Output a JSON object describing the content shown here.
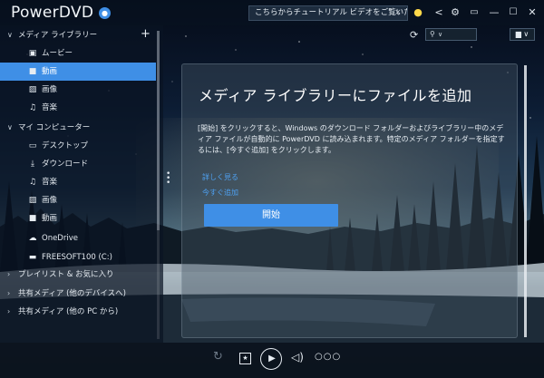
{
  "titlebar": {
    "app_title": "PowerDVD",
    "tip_text": "こちらからチュートリアル ビデオをご覧いただけます。",
    "tip_close": "×",
    "icons": [
      "notification-bell-icon",
      "lightbulb-icon",
      "share-icon",
      "gear-icon",
      "tv-mode-icon",
      "minimize-icon",
      "maximize-icon",
      "close-icon"
    ]
  },
  "sidebar": {
    "add_label": "+",
    "sections": [
      {
        "label": "メディア ライブラリー",
        "expanded": true,
        "items": [
          {
            "label": "ムービー",
            "icon": "movie-icon"
          },
          {
            "label": "動画",
            "icon": "video-icon",
            "selected": true
          },
          {
            "label": "画像",
            "icon": "image-icon"
          },
          {
            "label": "音楽",
            "icon": "music-icon"
          }
        ]
      },
      {
        "label": "マイ コンピューター",
        "expanded": true,
        "items": [
          {
            "label": "デスクトップ",
            "icon": "desktop-icon"
          },
          {
            "label": "ダウンロード",
            "icon": "download-icon"
          },
          {
            "label": "音楽",
            "icon": "music-icon"
          },
          {
            "label": "画像",
            "icon": "image-icon"
          },
          {
            "label": "動画",
            "icon": "video-icon"
          },
          {
            "label": "OneDrive",
            "icon": "cloud-icon"
          },
          {
            "label": "FREESOFT100 (C:)",
            "icon": "drive-icon"
          }
        ]
      },
      {
        "label": "プレイリスト & お気に入り",
        "expanded": false
      },
      {
        "label": "共有メディア (他のデバイスへ)",
        "expanded": false
      },
      {
        "label": "共有メディア (他の PC から)",
        "expanded": false
      }
    ]
  },
  "main": {
    "title": "メディア ライブラリーにファイルを追加",
    "description": "[開始] をクリックすると、Windows のダウンロード フォルダーおよびライブラリー中のメディア ファイルが自動的に PowerDVD に読み込まれます。特定のメディア フォルダーを指定するには、[今すぐ追加] をクリックします。",
    "link1": "詳しく見る",
    "link2": "今すぐ追加",
    "start_button": "開始"
  },
  "player": {
    "icons": [
      "repeat-icon",
      "chapter-icon",
      "play-icon",
      "volume-icon",
      "more-icon"
    ]
  },
  "colors": {
    "accent": "#3f8fe6",
    "link": "#4ea0f0"
  }
}
